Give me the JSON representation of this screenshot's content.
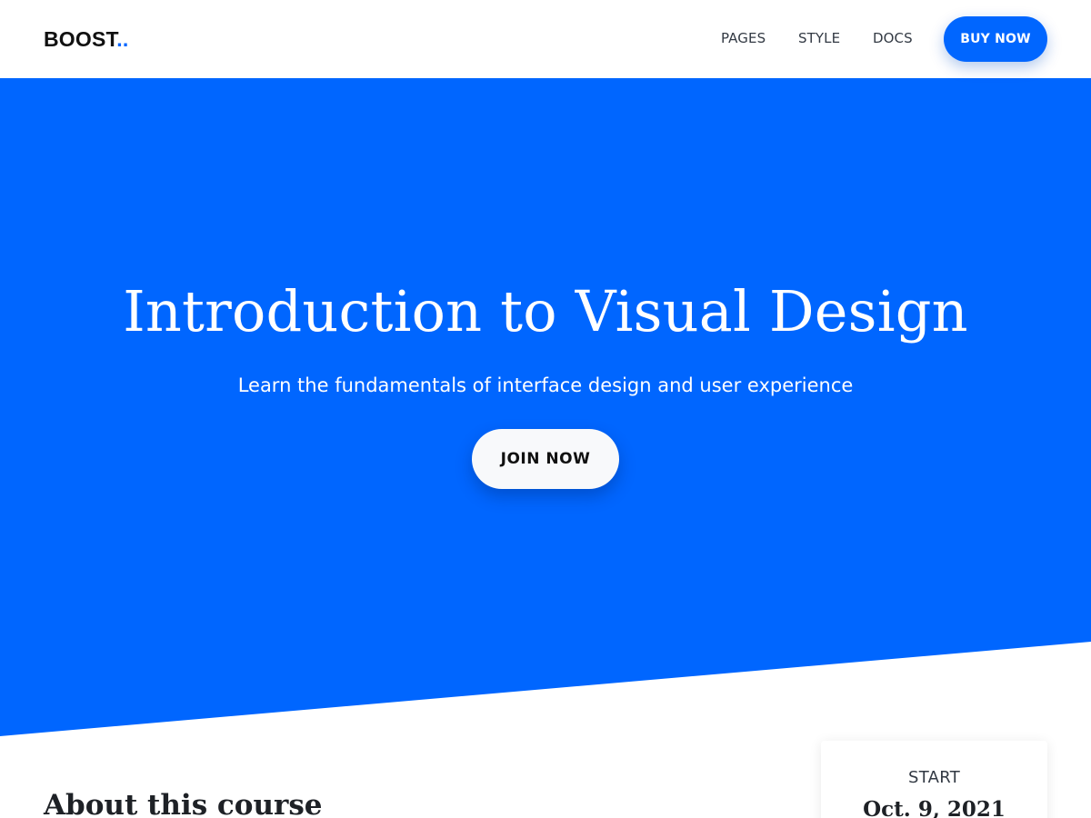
{
  "header": {
    "brand_text": "BOOST",
    "brand_dots": "..",
    "nav": [
      {
        "label": "PAGES"
      },
      {
        "label": "STYLE"
      },
      {
        "label": "DOCS"
      }
    ],
    "cta_label": "BUY NOW"
  },
  "hero": {
    "title": "Introduction to Visual Design",
    "subtitle": "Learn the fundamentals of interface design and user experience",
    "cta_label": "JOIN NOW"
  },
  "about": {
    "heading": "About this course"
  },
  "start_card": {
    "label": "START",
    "date": "Oct. 9, 2021"
  },
  "colors": {
    "accent": "#0066ff",
    "hero_background": "#0066ff",
    "text_dark": "#1e2126",
    "button_light": "#f8f9fb"
  }
}
